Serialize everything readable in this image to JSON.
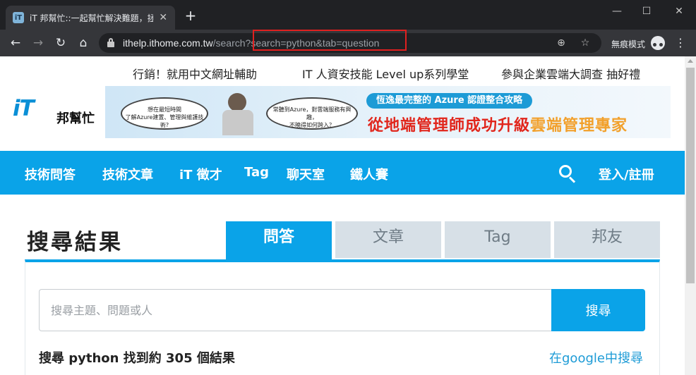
{
  "browser": {
    "tab_title": "iT 邦幫忙::一起幫忙解決難題，拯",
    "tab_favicon_text": "iT",
    "tab_close": "✕",
    "new_tab": "+",
    "url_host": "ithelp.ithome.com.tw",
    "url_path": "/search",
    "url_query": "?search=python&tab=question",
    "incognito_label": "無痕模式",
    "window_controls": {
      "minimize": "—",
      "maximize": "☐",
      "close": "✕"
    },
    "icons": [
      "back-arrow-icon",
      "forward-arrow-icon",
      "reload-icon",
      "home-icon",
      "lock-icon",
      "zoom-icon",
      "star-icon",
      "incognito-icon",
      "menu-icon"
    ],
    "highlight_color": "#e0201f"
  },
  "promo_links": [
    "行銷！就用中文網址輔助",
    "IT 人資安技能 Level up系列學堂",
    "參與企業雲端大調查 抽好禮"
  ],
  "logo": {
    "it": "iT",
    "bang": "邦幫忙"
  },
  "banner": {
    "bubble_left": "想在最短時間\n了解Azure建置、管理與維護技術?",
    "bubble_right": "常聽到Azure，對雲端服務有興趣，\n不曉得如何跨入？",
    "pill": "恆逸最完整的 Azure 認證整合攻略",
    "headline_main": "從地端管理師成功升級",
    "headline_accent": "雲端管理專家"
  },
  "nav": {
    "items": [
      "技術問答",
      "技術文章",
      "iT 徵才",
      "Tag",
      "聊天室",
      "鐵人賽"
    ],
    "login": "登入/註冊"
  },
  "results": {
    "title": "搜尋結果",
    "tabs": [
      {
        "label": "問答",
        "active": true
      },
      {
        "label": "文章",
        "active": false
      },
      {
        "label": "Tag",
        "active": false
      },
      {
        "label": "邦友",
        "active": false
      }
    ],
    "search_placeholder": "搜尋主題、問題或人",
    "search_value": "",
    "search_button": "搜尋",
    "count_text": "搜尋 python 找到約 305 個結果",
    "google_link": "在google中搜尋"
  },
  "colors": {
    "brand_blue": "#0aa3e8",
    "chrome_dark": "#202124",
    "chrome_toolbar": "#35363a"
  }
}
